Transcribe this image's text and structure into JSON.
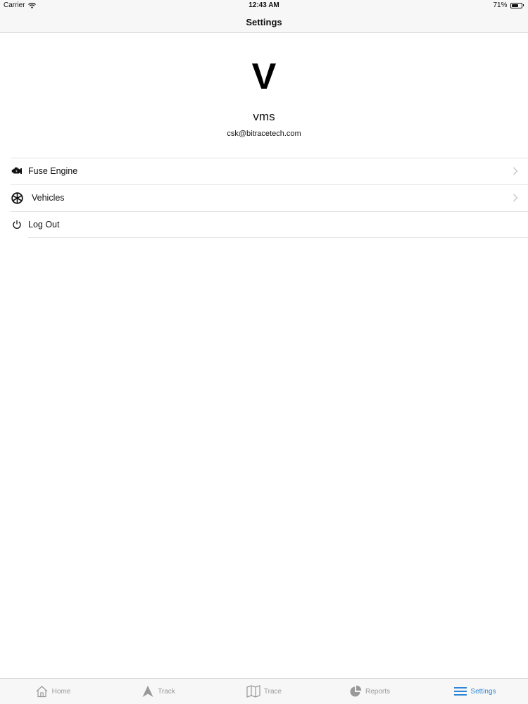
{
  "status_bar": {
    "carrier": "Carrier",
    "time": "12:43 AM",
    "battery_text": "71%",
    "battery_level": 0.71
  },
  "nav": {
    "title": "Settings"
  },
  "profile": {
    "initial": "V",
    "username": "vms",
    "email": "csk@bitracetech.com"
  },
  "menu": [
    {
      "label": "Fuse Engine",
      "icon": "engine-icon",
      "has_chevron": true
    },
    {
      "label": "Vehicles",
      "icon": "wheel-icon",
      "has_chevron": true
    },
    {
      "label": "Log Out",
      "icon": "power-icon",
      "has_chevron": false
    }
  ],
  "tabs": [
    {
      "label": "Home",
      "icon": "home-icon",
      "active": false
    },
    {
      "label": "Track",
      "icon": "navigation-arrow-icon",
      "active": false
    },
    {
      "label": "Trace",
      "icon": "map-icon",
      "active": false
    },
    {
      "label": "Reports",
      "icon": "pie-chart-icon",
      "active": false
    },
    {
      "label": "Settings",
      "icon": "menu-lines-icon",
      "active": true
    }
  ],
  "colors": {
    "accent": "#2f86d6",
    "inactive_tab": "#999999",
    "bar_background": "#f7f7f8",
    "separator": "#e3e3e6"
  }
}
